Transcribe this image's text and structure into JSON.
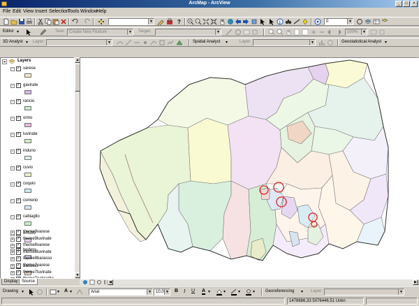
{
  "window": {
    "title": "ArcMap - ArcView"
  },
  "menu": [
    "File",
    "Edit",
    "View",
    "Insert",
    "Selection",
    "Tools",
    "Window",
    "Help"
  ],
  "standard_toolbar": {
    "scale_value": "",
    "right_value": "0"
  },
  "editor_toolbar": {
    "editor_label": "Editor",
    "task_label": "Task:",
    "task_value": "Create New Feature",
    "target_label": "Target:",
    "zoom_value": "100%"
  },
  "analyst_toolbar": {
    "three_d_analyst": "3D Analyst",
    "layer_label": "Layer:",
    "spatial_analyst": "Spatial Analyst",
    "layer2_label": "Layer:",
    "geostatistical_analyst": "Geostatistical Analyst"
  },
  "toc": {
    "root": "Layers",
    "layers": [
      {
        "name": "varese",
        "color": "#f5e6c8"
      },
      {
        "name": "gavirate",
        "color": "#d6b8e6"
      },
      {
        "name": "rancio",
        "color": "#ccecd2"
      },
      {
        "name": "orino",
        "color": "#e6b8dc"
      },
      {
        "name": "luvinate",
        "color": "#d2ecc4"
      },
      {
        "name": "induno",
        "color": "#d8f0e0"
      },
      {
        "name": "cuvio",
        "color": "#f0f0cc"
      },
      {
        "name": "coquio",
        "color": "#cfe8ec"
      },
      {
        "name": "comerio",
        "color": "#d8e8f8"
      },
      {
        "name": "cabiaglio",
        "color": "#c8f0c8"
      },
      {
        "name": "brinzio",
        "color": "#e8d0f0"
      },
      {
        "name": "bedero",
        "color": "#dcd0f0"
      },
      {
        "name": "barasso",
        "color": "#f0d8c8"
      },
      {
        "name": "arcisate",
        "color": "#c8e4c0"
      }
    ],
    "themes": [
      "theme9varese",
      "theme9luvinate",
      "theme8varese",
      "theme8luvinate",
      "theme8barasso",
      "theme7varese",
      "theme7luvinate",
      "theme7cabiaglio",
      "theme6varese"
    ]
  },
  "tabs": [
    "Display",
    "Source"
  ],
  "draw_toolbar": {
    "drawing_label": "Drawing",
    "font_name": "Arial",
    "font_size": "10,00",
    "bold": "B",
    "italic": "I",
    "underline": "U",
    "georef_label": "Georeferencing",
    "layer_label": "Layer:"
  },
  "status": {
    "coordinates": "1478686,33  5076446,51 Unkn"
  },
  "colors": {
    "highlight": "#e02020",
    "title_from": "#0a246a",
    "title_to": "#a6caf0"
  }
}
